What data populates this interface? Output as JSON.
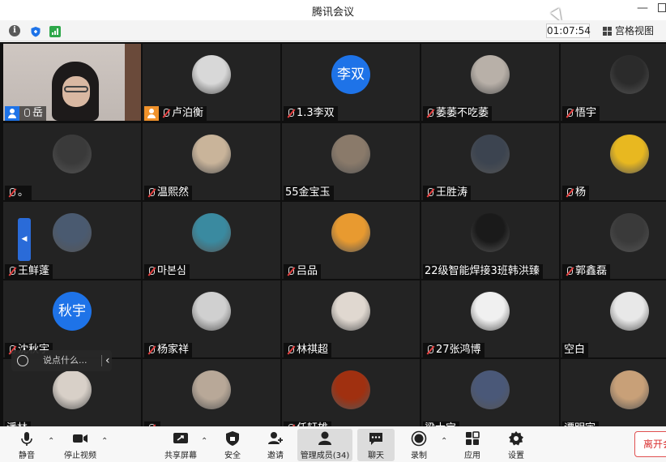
{
  "window": {
    "title": "腾讯会议"
  },
  "infobar": {
    "timer": "01:07:54",
    "view_label": "宫格视图"
  },
  "participants": [
    {
      "name": "岳",
      "type": "camera",
      "badge": "blue",
      "mic": "on"
    },
    {
      "name": "卢泊衡",
      "type": "photo",
      "badge": "orange",
      "mic": "muted",
      "av": "#d8d8d8"
    },
    {
      "name": "1.3李双",
      "type": "text",
      "avatar_text": "李双",
      "mic": "muted"
    },
    {
      "name": "萎萎不吃萎",
      "type": "photo",
      "mic": "muted",
      "av": "#b8b0a8"
    },
    {
      "name": "悟宇",
      "type": "photo",
      "mic": "muted",
      "av": "#2b2b2b"
    },
    {
      "name": "。",
      "type": "photo",
      "mic": "muted",
      "av": "#3a3a3a"
    },
    {
      "name": "温熙然",
      "type": "photo",
      "mic": "muted",
      "av": "#c9b49a"
    },
    {
      "name": "55金宝玉",
      "type": "photo",
      "mic": "none",
      "av": "#8a7a6a"
    },
    {
      "name": "王胜涛",
      "type": "photo",
      "mic": "muted",
      "av": "#3c4450"
    },
    {
      "name": "杨",
      "type": "photo",
      "mic": "muted",
      "av": "#e8b820"
    },
    {
      "name": "王鲜蓬",
      "type": "photo",
      "mic": "muted",
      "av": "#4a5a70"
    },
    {
      "name": "마본심",
      "type": "photo",
      "mic": "muted",
      "av": "#3a8aa0"
    },
    {
      "name": "吕品",
      "type": "photo",
      "mic": "muted",
      "av": "#e89a30"
    },
    {
      "name": "22级智能焊接3班韩洪臻",
      "type": "photo",
      "mic": "none",
      "av": "#1a1a1a"
    },
    {
      "name": "郭鑫磊",
      "type": "photo",
      "mic": "muted",
      "av": "#3a3a3a"
    },
    {
      "name": "沈秋宇",
      "type": "text",
      "avatar_text": "秋宇",
      "mic": "muted"
    },
    {
      "name": "杨家祥",
      "type": "photo",
      "mic": "muted",
      "av": "#d0d0d0"
    },
    {
      "name": "林祺超",
      "type": "photo",
      "mic": "muted",
      "av": "#e0d8d0"
    },
    {
      "name": "27张鸿博",
      "type": "photo",
      "mic": "muted",
      "av": "#f0f0f0"
    },
    {
      "name": "空白",
      "type": "photo",
      "mic": "none",
      "av": "#e8e8e8"
    },
    {
      "name": "潘林",
      "type": "photo",
      "mic": "none",
      "av": "#d8d0c8"
    },
    {
      "name": "",
      "type": "photo",
      "mic": "muted",
      "av": "#b8a898"
    },
    {
      "name": "任轩雄",
      "type": "photo",
      "mic": "muted",
      "av": "#a03010"
    },
    {
      "name": "梁士宝",
      "type": "photo",
      "mic": "none",
      "av": "#4a5878"
    },
    {
      "name": "谭明宇",
      "type": "photo",
      "mic": "none",
      "av": "#c8a078"
    }
  ],
  "chat_popup": {
    "placeholder": "说点什么..."
  },
  "toolbar": {
    "mute": "静音",
    "stop_video": "停止视频",
    "share": "共享屏幕",
    "security": "安全",
    "invite": "邀请",
    "members": "管理成员(34)",
    "chat": "聊天",
    "record": "录制",
    "apps": "应用",
    "settings": "设置",
    "leave": "离开会"
  },
  "colors": {
    "accent": "#1e73e8",
    "leave": "#d93030"
  }
}
